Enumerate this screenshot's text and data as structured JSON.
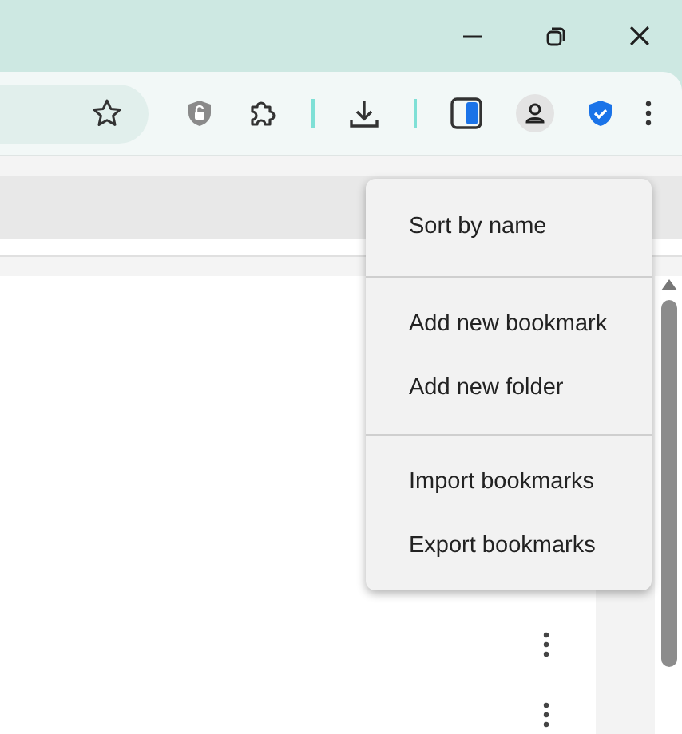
{
  "menu": {
    "groups": [
      {
        "items": [
          "Sort by name"
        ]
      },
      {
        "items": [
          "Add new bookmark",
          "Add new folder"
        ]
      },
      {
        "items": [
          "Import bookmarks",
          "Export bookmarks"
        ]
      }
    ]
  },
  "rows": [
    {
      "kind": "more"
    },
    {
      "kind": "more"
    }
  ]
}
